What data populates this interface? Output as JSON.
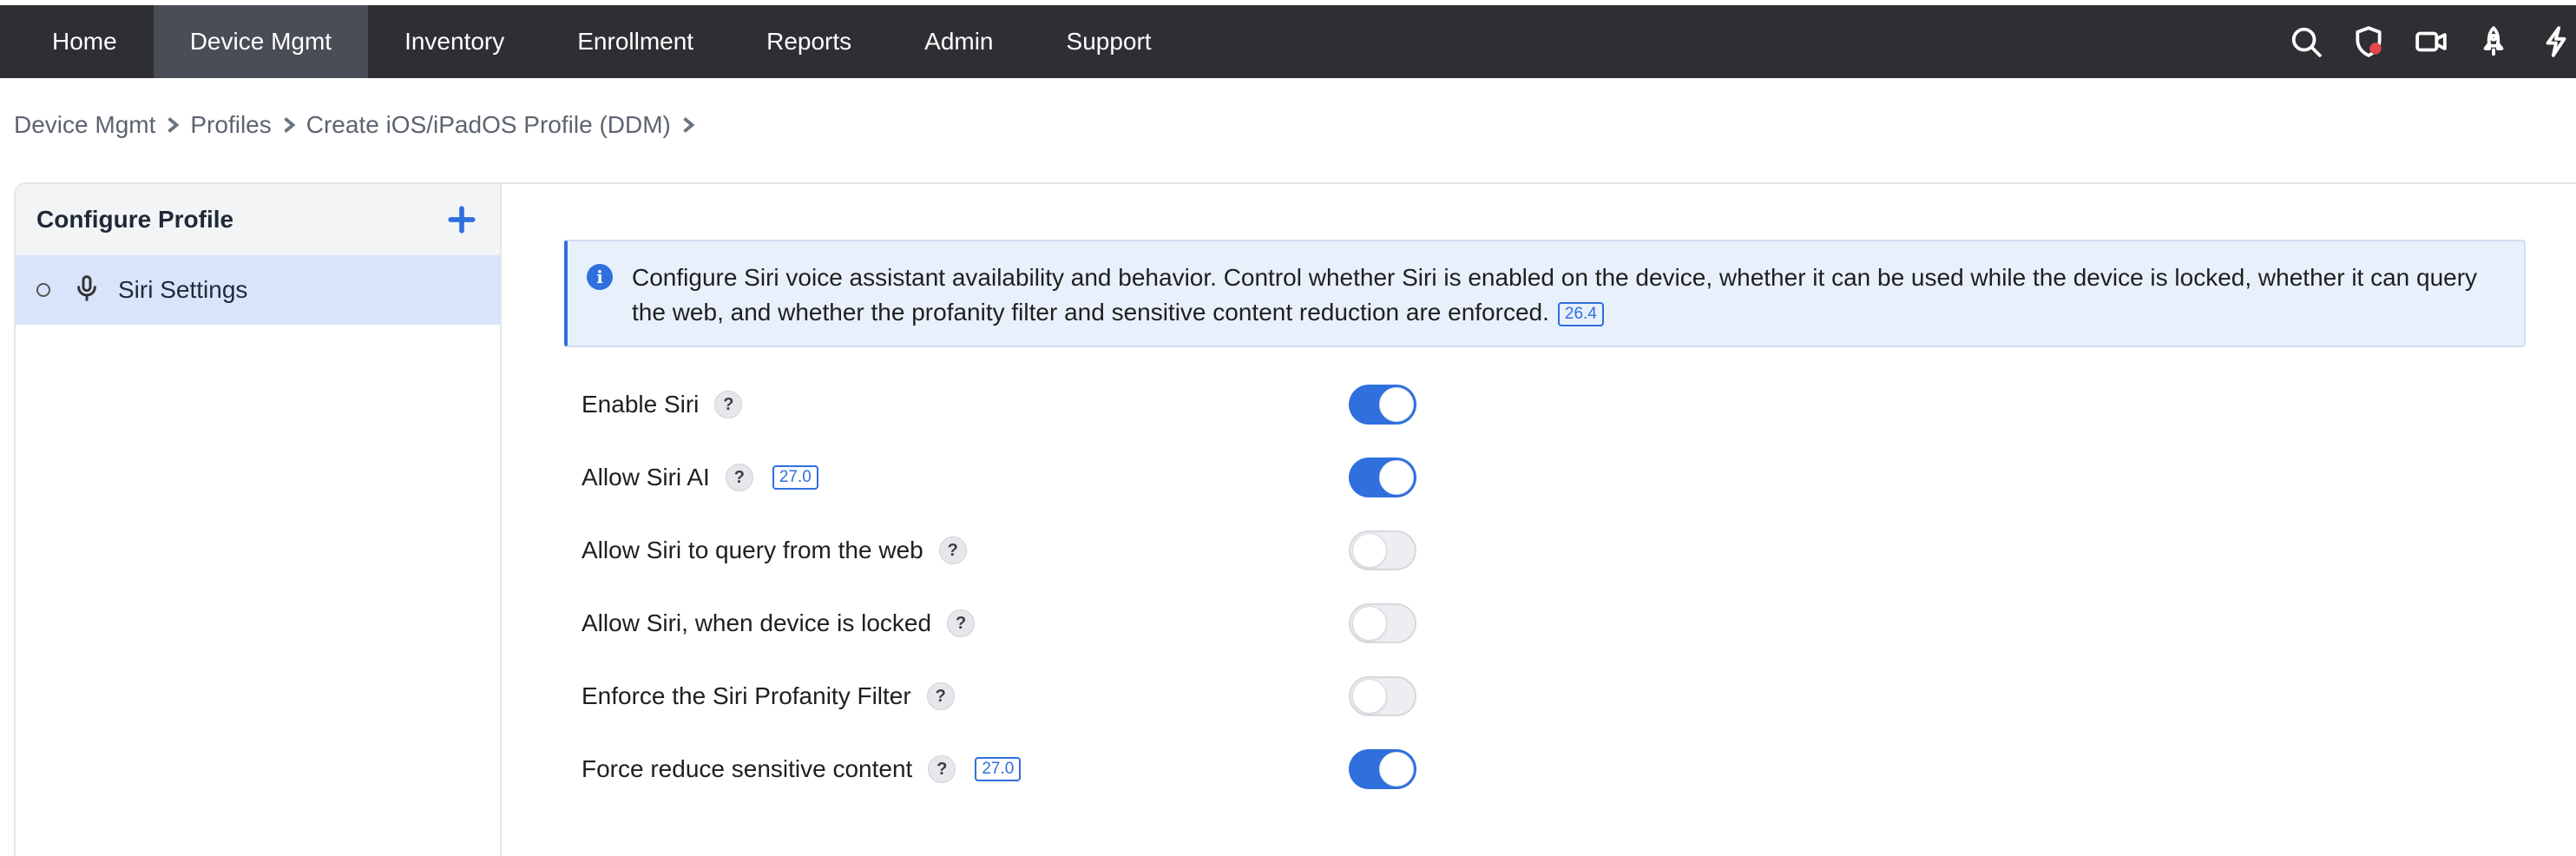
{
  "nav": {
    "items": [
      {
        "label": "Home",
        "active": false
      },
      {
        "label": "Device Mgmt",
        "active": true
      },
      {
        "label": "Inventory",
        "active": false
      },
      {
        "label": "Enrollment",
        "active": false
      },
      {
        "label": "Reports",
        "active": false
      },
      {
        "label": "Admin",
        "active": false
      },
      {
        "label": "Support",
        "active": false
      }
    ],
    "icons": [
      "search-icon",
      "shield-alert-icon",
      "video-icon",
      "rocket-icon",
      "lightning-icon"
    ]
  },
  "breadcrumb": [
    "Device Mgmt",
    "Profiles",
    "Create iOS/iPadOS Profile (DDM)"
  ],
  "sidebar": {
    "title": "Configure Profile",
    "items": [
      {
        "label": "Siri Settings",
        "icon": "microphone-icon",
        "selected": true
      }
    ]
  },
  "info": {
    "text": "Configure Siri voice assistant availability and behavior. Control whether Siri is enabled on the device, whether it can be used while the device is locked, whether it can query the web, and whether the profanity filter and sensitive content reduction are enforced.",
    "badge": "26.4"
  },
  "settings": [
    {
      "label": "Enable Siri",
      "badge": "",
      "enabled": true
    },
    {
      "label": "Allow Siri AI",
      "badge": "27.0",
      "enabled": true
    },
    {
      "label": "Allow Siri to query from the web",
      "badge": "",
      "enabled": false
    },
    {
      "label": "Allow Siri, when device is locked",
      "badge": "",
      "enabled": false
    },
    {
      "label": "Enforce the Siri Profanity Filter",
      "badge": "",
      "enabled": false
    },
    {
      "label": "Force reduce sensitive content",
      "badge": "27.0",
      "enabled": true
    }
  ],
  "help_glyph": "?",
  "colors": {
    "accent": "#2f6fde",
    "nav_bg": "#2d2f33",
    "nav_active": "#4a4d56",
    "selected_bg": "#d9e4fa",
    "info_bg": "#e8f0fc"
  }
}
